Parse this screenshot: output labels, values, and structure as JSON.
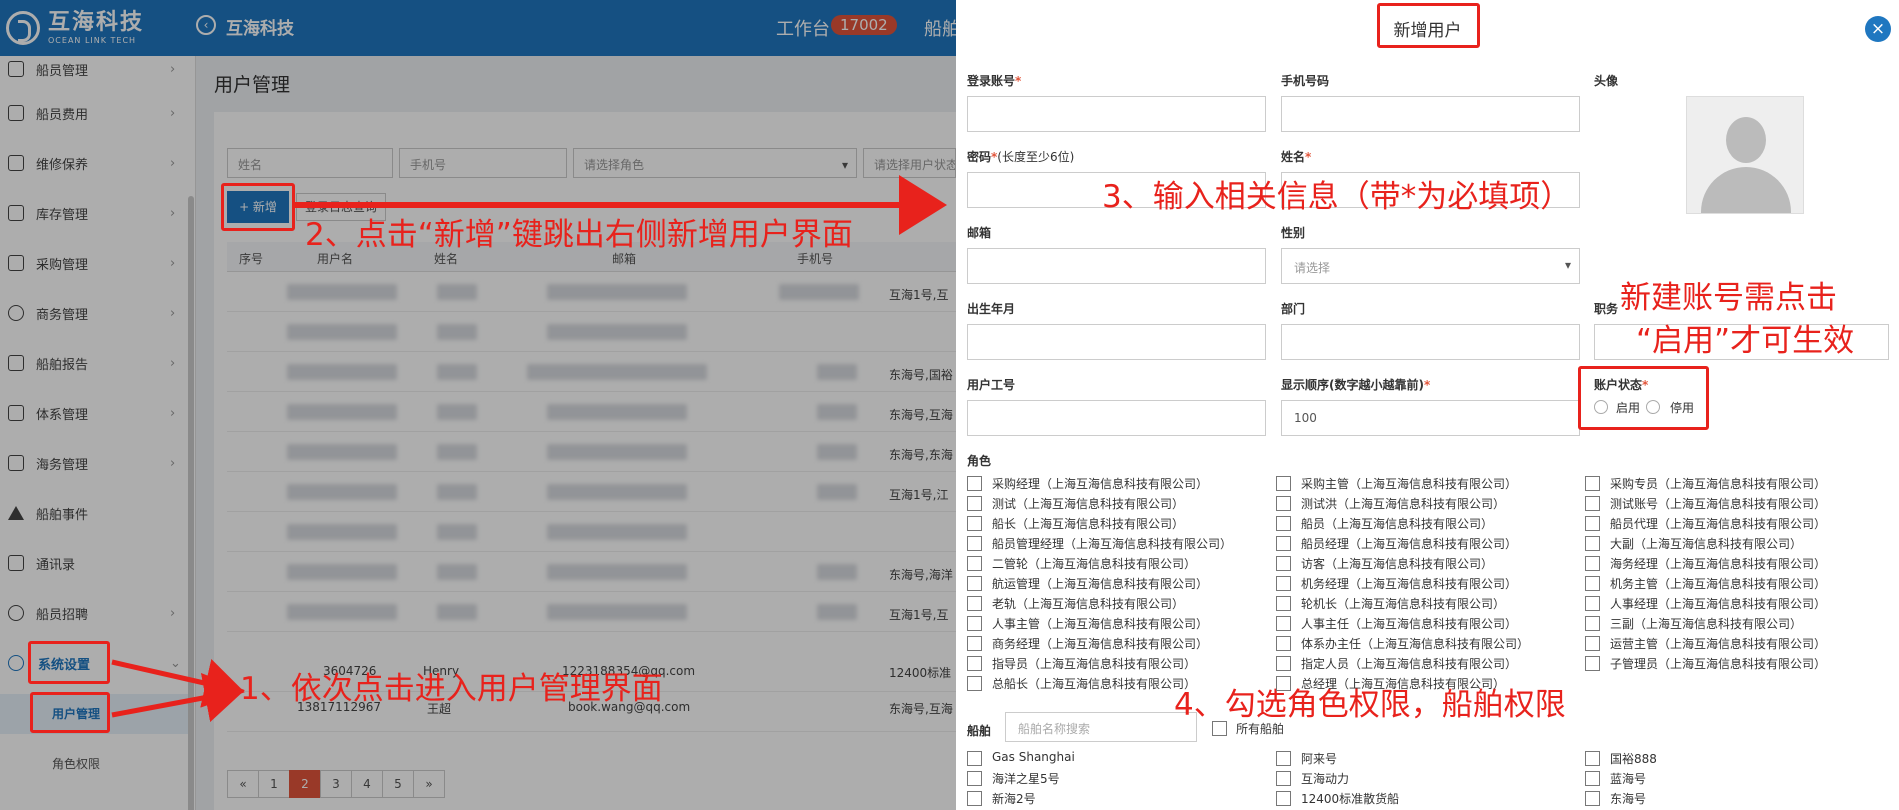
{
  "topbar": {
    "logo_cn": "互海科技",
    "logo_en": "OCEAN LINK TECH",
    "app_name": "互海科技",
    "workbench": "工作台",
    "badge": "17002",
    "nav_more": "船舶"
  },
  "sidebar": {
    "items": [
      {
        "label": "船员管理"
      },
      {
        "label": "船员费用"
      },
      {
        "label": "维修保养"
      },
      {
        "label": "库存管理"
      },
      {
        "label": "采购管理"
      },
      {
        "label": "商务管理"
      },
      {
        "label": "船舶报告"
      },
      {
        "label": "体系管理"
      },
      {
        "label": "海务管理"
      },
      {
        "label": "船舶事件"
      },
      {
        "label": "通讯录"
      },
      {
        "label": "船员招聘"
      },
      {
        "label": "系统设置"
      }
    ],
    "sub_items": [
      {
        "label": "用户管理"
      },
      {
        "label": "角色权限"
      }
    ]
  },
  "main": {
    "title": "用户管理",
    "filters": {
      "name": "姓名",
      "phone": "手机号",
      "role": "请选择角色",
      "status": "请选择用户状态"
    },
    "add_button": "+ 新增",
    "log_button": "登录日志查询",
    "columns": [
      "序号",
      "用户名",
      "姓名",
      "邮箱",
      "手机号"
    ],
    "rows": [
      {
        "ship": "互海1号,互"
      },
      {
        "ship": "东海号,国裕"
      },
      {
        "ship": "东海号,互海"
      },
      {
        "ship": "东海号,东海"
      },
      {
        "ship": "互海1号,江"
      },
      {
        "ship": ""
      },
      {
        "ship": "东海号,海洋"
      },
      {
        "ship": "互海1号,互"
      },
      {
        "username": "3604726",
        "name": "Henry",
        "email": "1223188354@qq.com",
        "ship": "12400标准"
      },
      {
        "username": "13817112967",
        "name": "王超",
        "email": "book.wang@qq.com",
        "ship": "东海号,互海"
      }
    ],
    "pager": [
      "«",
      "1",
      "2",
      "3",
      "4",
      "5",
      "»"
    ]
  },
  "modal": {
    "title": "新增用户",
    "fields": {
      "login": "登录账号",
      "phone": "手机号码",
      "avatar": "头像",
      "password": "密码",
      "password_hint": "(长度至少6位)",
      "name": "姓名",
      "email": "邮箱",
      "gender": "性别",
      "gender_placeholder": "请选择",
      "birth": "出生年月",
      "dept": "部门",
      "position": "职务",
      "employee_no": "用户工号",
      "order": "显示顺序(数字越小越靠前)",
      "order_value": "100",
      "status": "账户状态",
      "status_on": "启用",
      "status_off": "停用",
      "roles": "角色",
      "ships": "船舶",
      "ship_search_placeholder": "船舶名称搜索",
      "all_ships": "所有船舶"
    },
    "roles": [
      [
        "采购经理（上海互海信息科技有限公司）",
        "采购主管（上海互海信息科技有限公司）",
        "采购专员（上海互海信息科技有限公司）"
      ],
      [
        "测试（上海互海信息科技有限公司）",
        "测试洪（上海互海信息科技有限公司）",
        "测试账号（上海互海信息科技有限公司）"
      ],
      [
        "船长（上海互海信息科技有限公司）",
        "船员（上海互海信息科技有限公司）",
        "船员代理（上海互海信息科技有限公司）"
      ],
      [
        "船员管理经理（上海互海信息科技有限公司）",
        "船员经理（上海互海信息科技有限公司）",
        "大副（上海互海信息科技有限公司）"
      ],
      [
        "二管轮（上海互海信息科技有限公司）",
        "访客（上海互海信息科技有限公司）",
        "海务经理（上海互海信息科技有限公司）"
      ],
      [
        "航运管理（上海互海信息科技有限公司）",
        "机务经理（上海互海信息科技有限公司）",
        "机务主管（上海互海信息科技有限公司）"
      ],
      [
        "老轨（上海互海信息科技有限公司）",
        "轮机长（上海互海信息科技有限公司）",
        "人事经理（上海互海信息科技有限公司）"
      ],
      [
        "人事主管（上海互海信息科技有限公司）",
        "人事主任（上海互海信息科技有限公司）",
        "三副（上海互海信息科技有限公司）"
      ],
      [
        "商务经理（上海互海信息科技有限公司）",
        "体系办主任（上海互海信息科技有限公司）",
        "运营主管（上海互海信息科技有限公司）"
      ],
      [
        "指导员（上海互海信息科技有限公司）",
        "指定人员（上海互海信息科技有限公司）",
        "子管理员（上海互海信息科技有限公司）"
      ],
      [
        "总船长（上海互海信息科技有限公司）",
        "总经理（上海互海信息科技有限公司）",
        ""
      ]
    ],
    "ships": [
      [
        "Gas Shanghai",
        "阿来号",
        "国裕888"
      ],
      [
        "海洋之星5号",
        "互海动力",
        "蓝海号"
      ],
      [
        "新海2号",
        "12400标准散货船",
        "东海号"
      ]
    ]
  },
  "annotations": {
    "step1": "1、依次点击进入用户管理界面",
    "step2": "2、点击“新增”键跳出右侧新增用户界面",
    "step3": "3、输入相关信息（带*为必填项）",
    "step4": "4、勾选角色权限，船舶权限",
    "note_line1": "新建账号需点击",
    "note_line2": "“启用”才可生效"
  },
  "colors": {
    "brand": "#1f77c0",
    "badge": "#e2553b",
    "annotation": "#e8221c"
  }
}
